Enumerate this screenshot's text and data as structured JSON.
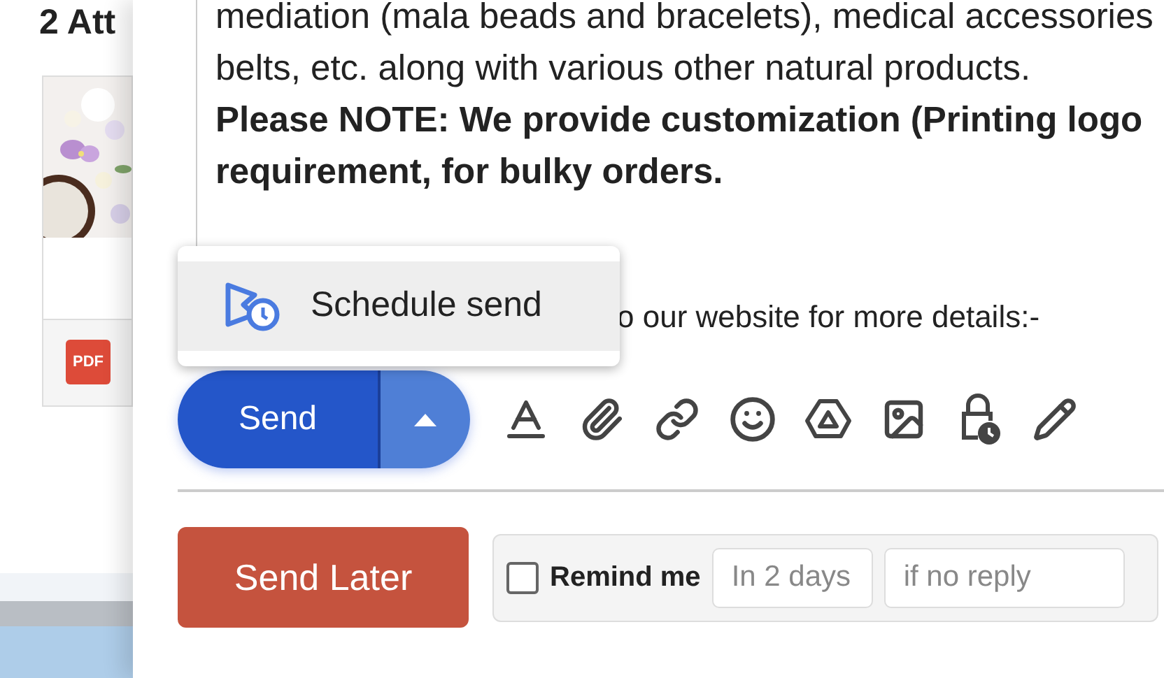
{
  "attachments": {
    "title": "2 Att",
    "items": [
      {
        "kind": "picture"
      },
      {
        "kind": "file",
        "label": "PDF"
      }
    ]
  },
  "compose": {
    "body_lines": [
      {
        "text": "mediation (mala beads and bracelets), medical accessories",
        "bold": false
      },
      {
        "text": "belts, etc. along with various other natural products.",
        "bold": false
      },
      {
        "text": "Please NOTE: We provide customization (Printing logo",
        "bold": true
      },
      {
        "text": "requirement, for bulky orders.",
        "bold": true
      }
    ],
    "partial_line": "o our website for more details:-",
    "send_menu": {
      "open": true,
      "items": [
        "Schedule send"
      ]
    },
    "send_button": "Send",
    "send_later_button": "Send Later",
    "reminder": {
      "checked": false,
      "label": "Remind me",
      "fields": [
        {
          "placeholder": "In 2 days"
        },
        {
          "placeholder": "if no reply"
        }
      ]
    }
  }
}
